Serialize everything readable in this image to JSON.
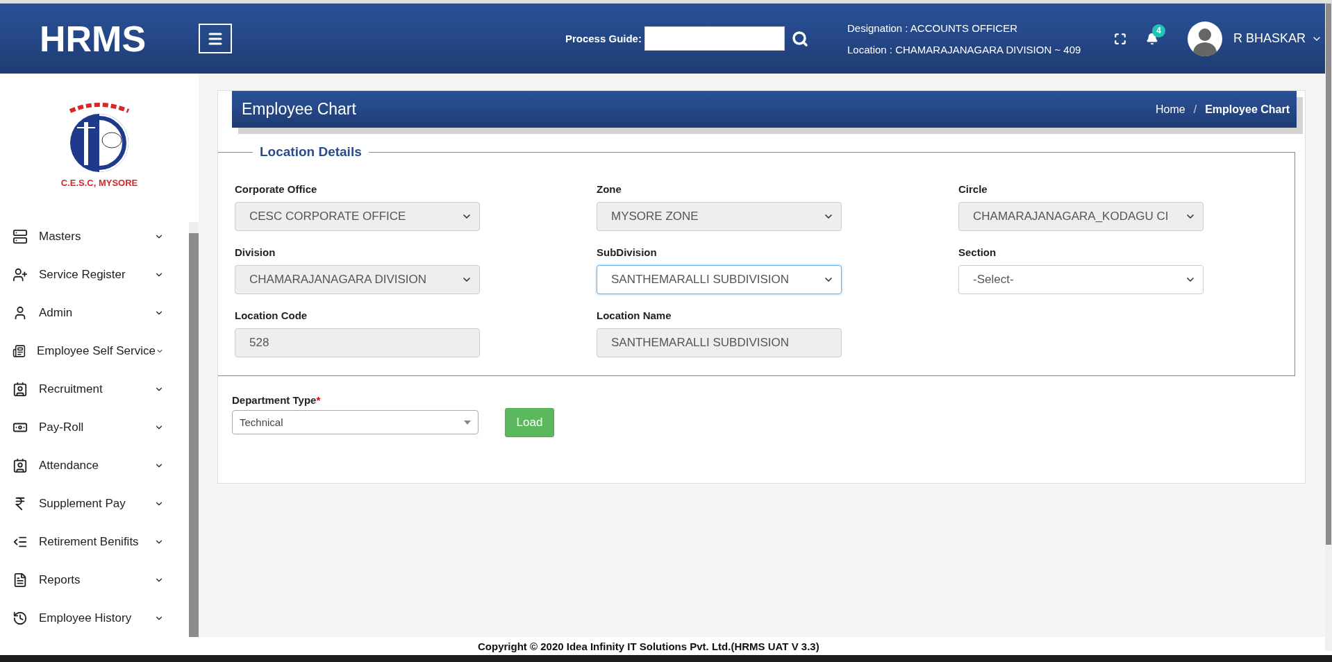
{
  "header": {
    "brand": "HRMS",
    "process_guide": {
      "label": "Process Guide:"
    },
    "designation": "Designation : ACCOUNTS OFFICER",
    "location": "Location : CHAMARAJANAGARA DIVISION ~ 409",
    "notifications": "4",
    "user": "R BHASKAR"
  },
  "sidebar": {
    "logo_text": "C.E.S.C, MYSORE",
    "items": [
      {
        "label": "Masters"
      },
      {
        "label": "Service Register"
      },
      {
        "label": "Admin"
      },
      {
        "label": "Employee Self Service"
      },
      {
        "label": "Recruitment"
      },
      {
        "label": "Pay-Roll"
      },
      {
        "label": "Attendance"
      },
      {
        "label": "Supplement Pay"
      },
      {
        "label": "Retirement Benifits"
      },
      {
        "label": "Reports"
      },
      {
        "label": "Employee History"
      }
    ]
  },
  "page": {
    "title": "Employee Chart",
    "breadcrumb": [
      {
        "label": "Home",
        "selected": false
      },
      {
        "label": "Employee Chart",
        "selected": true
      }
    ],
    "breadcrumb_separator": "/"
  },
  "location_details": {
    "legend": "Location Details",
    "fields": [
      {
        "label": "Corporate Office",
        "value": "CESC CORPORATE OFFICE",
        "kind": "select",
        "disabled": true,
        "focused": false
      },
      {
        "label": "Zone",
        "value": "MYSORE ZONE",
        "kind": "select",
        "disabled": true,
        "focused": false
      },
      {
        "label": "Circle",
        "value": "CHAMARAJANAGARA_KODAGU CI",
        "kind": "select",
        "disabled": true,
        "focused": false
      },
      {
        "label": "Division",
        "value": "CHAMARAJANAGARA DIVISION",
        "kind": "select",
        "disabled": true,
        "focused": false
      },
      {
        "label": "SubDivision",
        "value": "SANTHEMARALLI SUBDIVISION",
        "kind": "select",
        "disabled": false,
        "focused": true
      },
      {
        "label": "Section",
        "value": "-Select-",
        "kind": "select",
        "disabled": false,
        "focused": false
      },
      {
        "label": "Location Code",
        "value": "528",
        "kind": "text",
        "disabled": true,
        "focused": false
      },
      {
        "label": "Location Name",
        "value": "SANTHEMARALLI SUBDIVISION",
        "kind": "text",
        "disabled": true,
        "focused": false
      }
    ]
  },
  "department": {
    "label": "Department Type",
    "required_mark": "*",
    "value": "Technical",
    "button": "Load"
  },
  "footer": "Copyright © 2020 Idea Infinity IT Solutions Pvt. Ltd.(HRMS UAT V 3.3)"
}
